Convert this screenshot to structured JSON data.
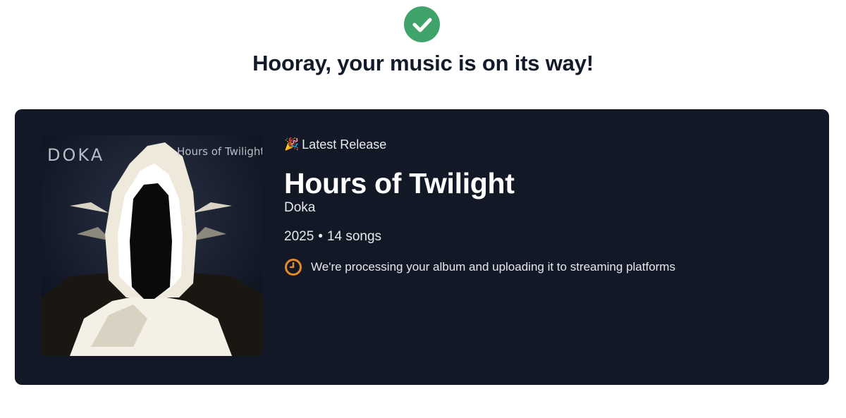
{
  "header": {
    "success_icon": "check-circle-icon",
    "title": "Hooray, your music is on its way!"
  },
  "release": {
    "badge_icon": "party-popper-icon",
    "badge_label": "Latest Release",
    "title": "Hours of Twilight",
    "artist": "Doka",
    "year": "2025",
    "separator": "•",
    "song_count": "14 songs",
    "status_icon": "clock-icon",
    "status_text": "We're processing your album and uploading it to streaming platforms",
    "cover": {
      "artist_text": "DOKA",
      "title_text": "Hours of Twilight"
    }
  },
  "colors": {
    "success": "#3fa36b",
    "card_background": "#121826",
    "status_icon": "#e08a2c"
  }
}
